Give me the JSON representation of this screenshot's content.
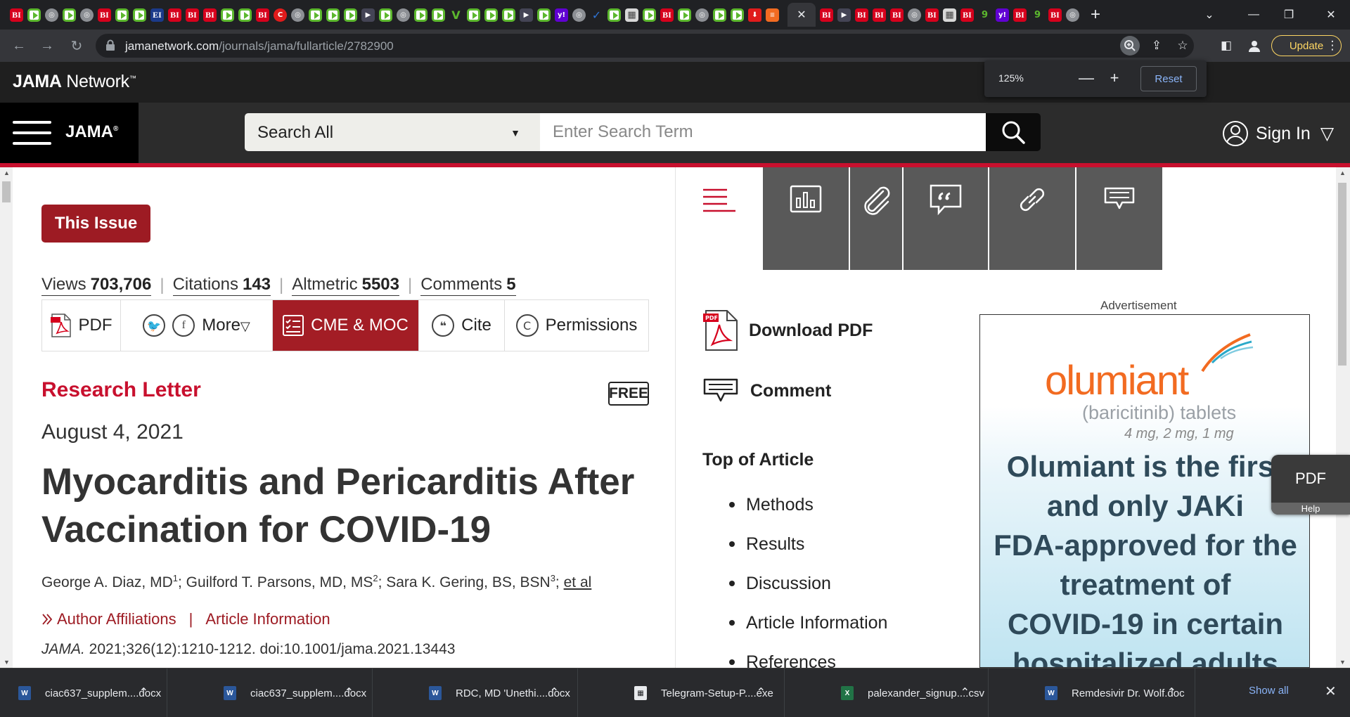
{
  "browser": {
    "tab_favicons": [
      "BI",
      "play",
      "globe",
      "play",
      "globe",
      "BI",
      "play",
      "play",
      "EI",
      "BI",
      "BI",
      "BI",
      "play",
      "play",
      "BI",
      "red",
      "globe",
      "play",
      "play",
      "play",
      "dark",
      "play",
      "globe",
      "play",
      "play",
      "V",
      "play",
      "play",
      "play",
      "dark",
      "play",
      "y!",
      "globe",
      "check",
      "play",
      "grid",
      "play",
      "BI",
      "play",
      "globe",
      "play",
      "play",
      "pin",
      "bars"
    ],
    "tab_favicons_after": [
      "BI",
      "dark",
      "BI",
      "BI",
      "BI",
      "globe",
      "BI",
      "grid",
      "BI",
      "9",
      "y!",
      "BI",
      "9",
      "BI",
      "globe"
    ],
    "active_tab_close": "✕",
    "new_tab": "+",
    "url_host": "jamanetwork.com",
    "url_path": "/journals/jama/fullarticle/2782900",
    "update_label": "Update",
    "zoom": {
      "value": "125%",
      "minus": "—",
      "plus": "+",
      "reset": "Reset"
    }
  },
  "network_bar": {
    "logo_bold": "JAMA",
    "logo_rest": " Network",
    "tm": "™"
  },
  "header": {
    "brand": "JAMA",
    "brand_mark": "®",
    "search_scope": "Search All",
    "search_scope_caret": "▼",
    "search_placeholder": "Enter Search Term",
    "signin_label": "Sign In",
    "signin_caret": "▽"
  },
  "article": {
    "this_issue": "This Issue",
    "metrics": [
      {
        "label": "Views",
        "value": "703,706"
      },
      {
        "label": "Citations",
        "value": "143"
      },
      {
        "label": "Altmetric",
        "value": "5503"
      },
      {
        "label": "Comments",
        "value": "5"
      }
    ],
    "tools": {
      "pdf": "PDF",
      "more": "More",
      "more_caret": "▽",
      "cme": "CME & MOC",
      "cite": "Cite",
      "permissions": "Permissions"
    },
    "type": "Research Letter",
    "free": "FREE",
    "date": "August 4, 2021",
    "title": "Myocarditis and Pericarditis After Vaccination for COVID-19",
    "authors": [
      {
        "name": "George A. Diaz, MD",
        "sup": "1"
      },
      {
        "name": "Guilford T. Parsons, MD, MS",
        "sup": "2"
      },
      {
        "name": "Sara K. Gering, BS, BSN",
        "sup": "3"
      }
    ],
    "et_al": "et al",
    "affiliations": "Author Affiliations",
    "article_info": "Article Information",
    "affil_sep": "|",
    "journal": "JAMA.",
    "citation": " 2021;326(12):1210-1212. doi:10.1001/jama.2021.13443"
  },
  "right_panel": {
    "download_pdf": "Download PDF",
    "comment": "Comment",
    "top_of_article": "Top of Article",
    "toc": [
      "Methods",
      "Results",
      "Discussion",
      "Article Information",
      "References"
    ]
  },
  "ad": {
    "label": "Advertisement",
    "brand": "olumiant",
    "subtitle": "(baricitinib) tablets",
    "dose": "4 mg, 2 mg, 1 mg",
    "lines": [
      "Olumiant is the first",
      "and only JAKi",
      "FDA-approved for the",
      "treatment of",
      "COVID-19 in certain",
      "hospitalized adults"
    ]
  },
  "pdf_float": {
    "label": "PDF",
    "help": "Help"
  },
  "downloads": [
    {
      "name": "ciac637_supplem....docx",
      "type": "docx"
    },
    {
      "name": "ciac637_supplem....docx",
      "type": "docx"
    },
    {
      "name": "RDC, MD 'Unethi....docx",
      "type": "docx"
    },
    {
      "name": "Telegram-Setup-P....exe",
      "type": "exe"
    },
    {
      "name": "palexander_signup....csv",
      "type": "csv"
    },
    {
      "name": "Remdesivir Dr. Wolf.doc",
      "type": "doc"
    }
  ],
  "show_all": "Show all",
  "shelf_close": "✕",
  "colors": {
    "jama_red": "#c8102e",
    "cme_red": "#a31d25",
    "ad_orange": "#f26b21",
    "chrome_blue": "#8ab4f8"
  }
}
